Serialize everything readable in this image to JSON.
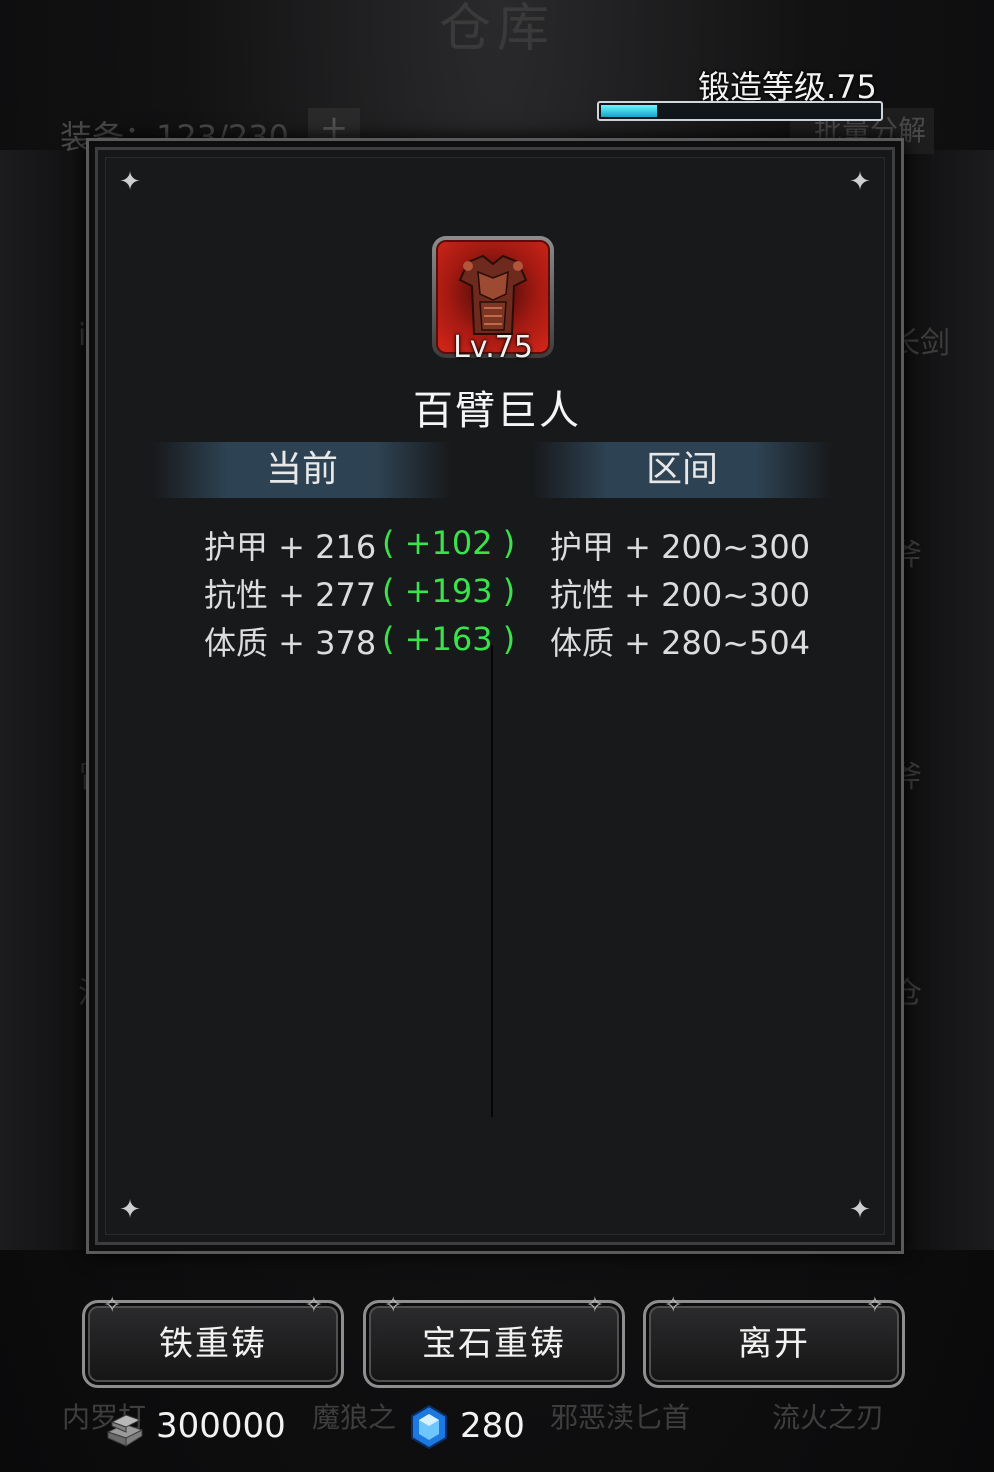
{
  "background": {
    "title": "仓库",
    "equip_count": "装备：123/230",
    "plus_button": "+",
    "batch_button": "批量分解",
    "fragments_left": [
      "i",
      "冒",
      "治"
    ],
    "fragments_right": [
      "长剑",
      "斧",
      "斧",
      "仓"
    ],
    "bottom_names": [
      "内罗打",
      "魔狼之",
      "邪恶渎匕首",
      "流火之刃"
    ]
  },
  "forge": {
    "label": "锻造等级.75",
    "progress": 0.2
  },
  "item": {
    "icon": "armor-icon",
    "level": "Lv.75",
    "name": "百臂巨人",
    "frame_color": "#d6261a"
  },
  "headers": {
    "current": "当前",
    "range": "区间"
  },
  "stats": [
    {
      "label": "护甲 + 216",
      "bonus": "( +102 )",
      "range": "护甲 + 200~300"
    },
    {
      "label": "抗性 + 277",
      "bonus": "( +193 )",
      "range": "抗性 + 200~300"
    },
    {
      "label": "体质 + 378",
      "bonus": "( +163 )",
      "range": "体质 + 280~504"
    }
  ],
  "buttons": {
    "iron_reforge": "铁重铸",
    "gem_reforge": "宝石重铸",
    "leave": "离开"
  },
  "currency": {
    "iron": "300000",
    "iron_icon": "iron-ingot-icon",
    "gem": "280",
    "gem_icon": "blue-gem-icon"
  },
  "colors": {
    "bonus": "#39e34a",
    "forge_bar": "#14a8c4",
    "header_band": "#2d4252"
  }
}
